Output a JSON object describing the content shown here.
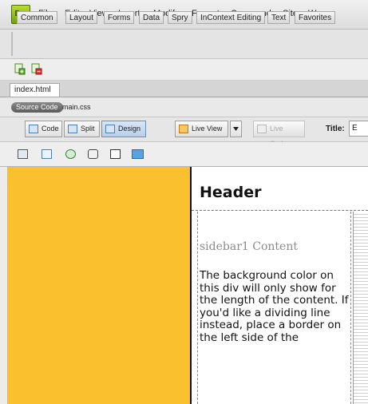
{
  "app": {
    "logo_text": "Dw",
    "menu": [
      "File",
      "Edit",
      "View",
      "Insert",
      "Modify",
      "Format",
      "Commands",
      "Site",
      "W"
    ]
  },
  "insert_panel": {
    "tabs": [
      "Common",
      "Layout",
      "Forms",
      "Data",
      "Spry",
      "InContext Editing",
      "Text",
      "Favorites"
    ]
  },
  "document": {
    "tab_label": "index.html",
    "tab_close": "×",
    "related_files": [
      "Source Code",
      "main.css"
    ]
  },
  "view_toolbar": {
    "code": "Code",
    "split": "Split",
    "design": "Design",
    "live_view": "Live View",
    "live_code": "Live Code",
    "title_label": "Title:",
    "title_value": "E"
  },
  "design_view": {
    "header": "Header",
    "sidebar_heading": "sidebar1 Content",
    "sidebar_body": "The background color on this div will only show for the length of the content. If you'd like a dividing line instead, place a border on the left side of the"
  },
  "colors": {
    "sidebar_background": "#fbc02d",
    "logo_green": "#8dbb1d"
  }
}
